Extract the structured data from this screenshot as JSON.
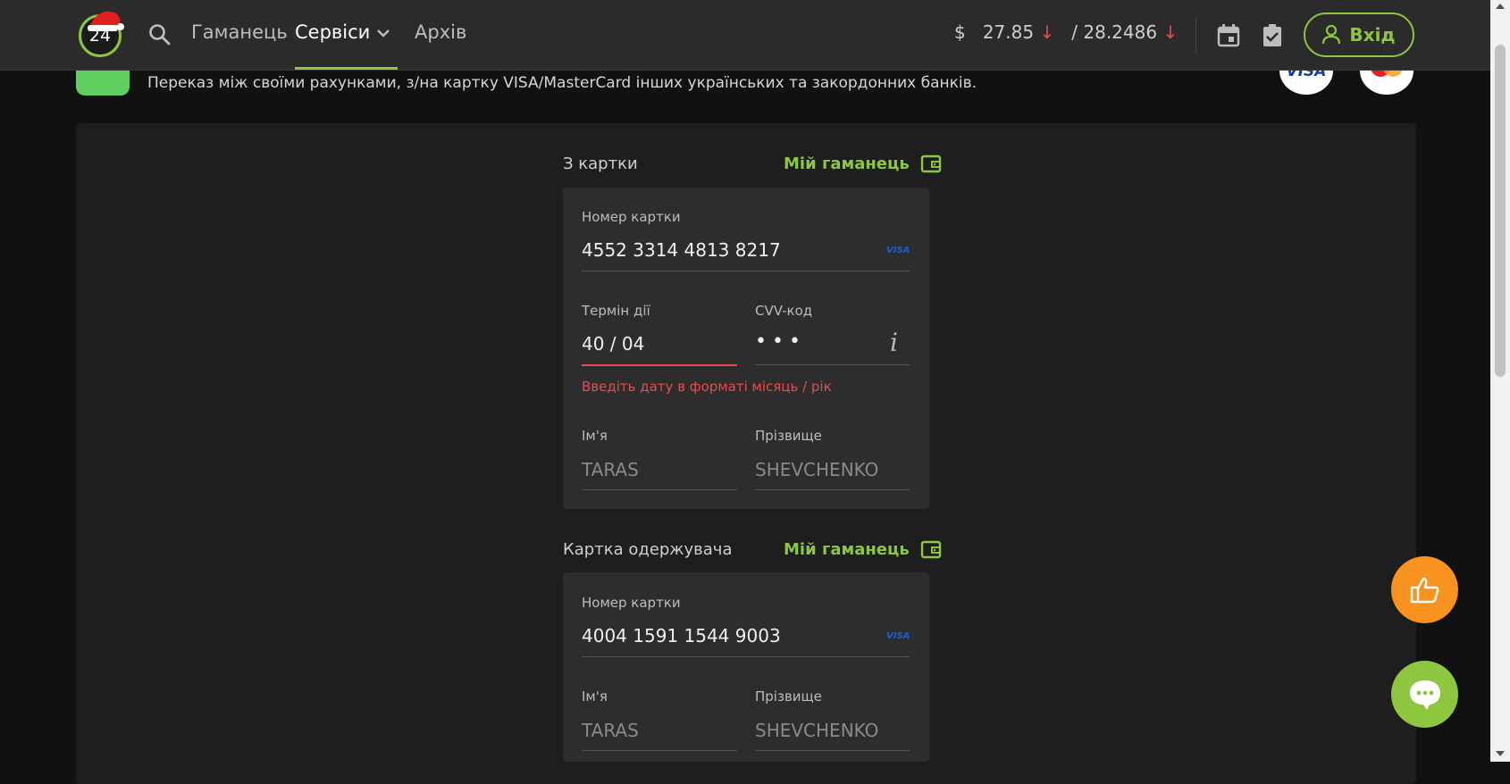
{
  "header": {
    "logo_text": "24",
    "nav": {
      "wallet": "Гаманець",
      "services": "Сервіси",
      "archive": "Архів"
    },
    "rates": {
      "currency": "$",
      "buy": "27.85",
      "buy_trend": "↓",
      "sell": "/ 28.2486",
      "sell_trend": "↓"
    },
    "login_label": "Вхід",
    "icons": [
      "search-icon",
      "chevron-down-icon",
      "calendar-icon",
      "clipboard-check-icon",
      "user-icon"
    ]
  },
  "service": {
    "description": "Переказ між своїми рахунками, з/на картку VISA/MasterCard інших українських та закордонних банків.",
    "visa_brand": "VISA"
  },
  "from_card": {
    "section_label": "З картки",
    "wallet_link": "Мій гаманець",
    "number_label": "Номер картки",
    "number_value": "4552 3314 4813 8217",
    "card_brand": "VISA",
    "expiry_label": "Термін дії",
    "expiry_value": "40 / 04",
    "cvv_label": "CVV-код",
    "cvv_value": "•••",
    "info_glyph": "i",
    "error_text": "Введіть дату в форматі місяць / рік",
    "first_name_label": "Ім'я",
    "first_name_placeholder": "TARAS",
    "last_name_label": "Прізвище",
    "last_name_placeholder": "SHEVCHENKO"
  },
  "to_card": {
    "section_label": "Картка одержувача",
    "wallet_link": "Мій гаманець",
    "number_label": "Номер картки",
    "number_value": "4004 1591 1544 9003",
    "card_brand": "VISA",
    "first_name_label": "Ім'я",
    "first_name_placeholder": "TARAS",
    "last_name_label": "Прізвище",
    "last_name_placeholder": "SHEVCHENKO"
  },
  "colors": {
    "accent": "#8dc63f",
    "error": "#e94b4b",
    "feedback": "#f7931e",
    "background": "#111111",
    "card": "#2d2d2d"
  }
}
